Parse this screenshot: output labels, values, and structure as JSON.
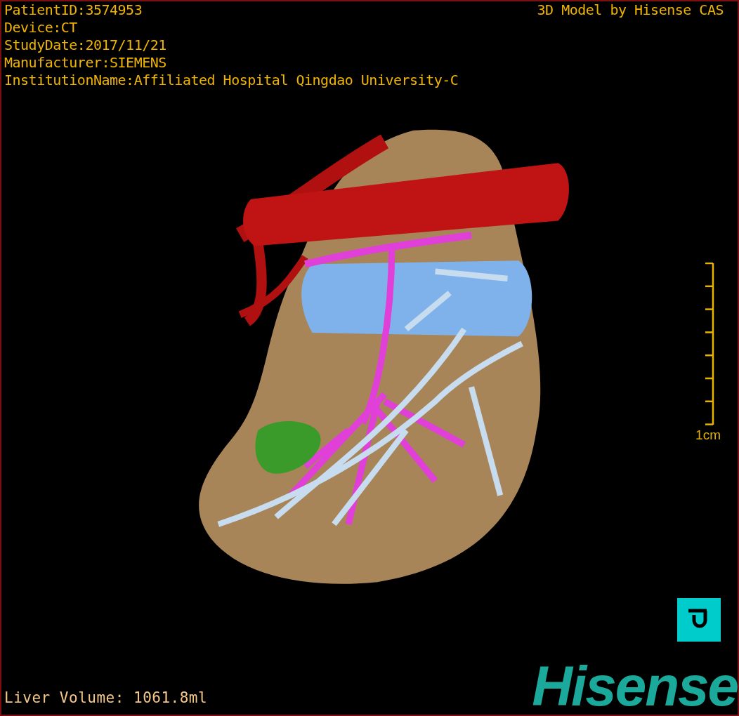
{
  "study_info": [
    "PatientID:3574953",
    "Device:CT",
    "StudyDate:2017/11/21",
    "Manufacturer:SIEMENS",
    "InstitutionName:Affiliated Hospital Qingdao University-C"
  ],
  "title": "3D Model by Hisense CAS",
  "scale_bar": {
    "label": "1cm"
  },
  "volume": "Liver Volume: 1061.8ml",
  "logo": "Hisense"
}
